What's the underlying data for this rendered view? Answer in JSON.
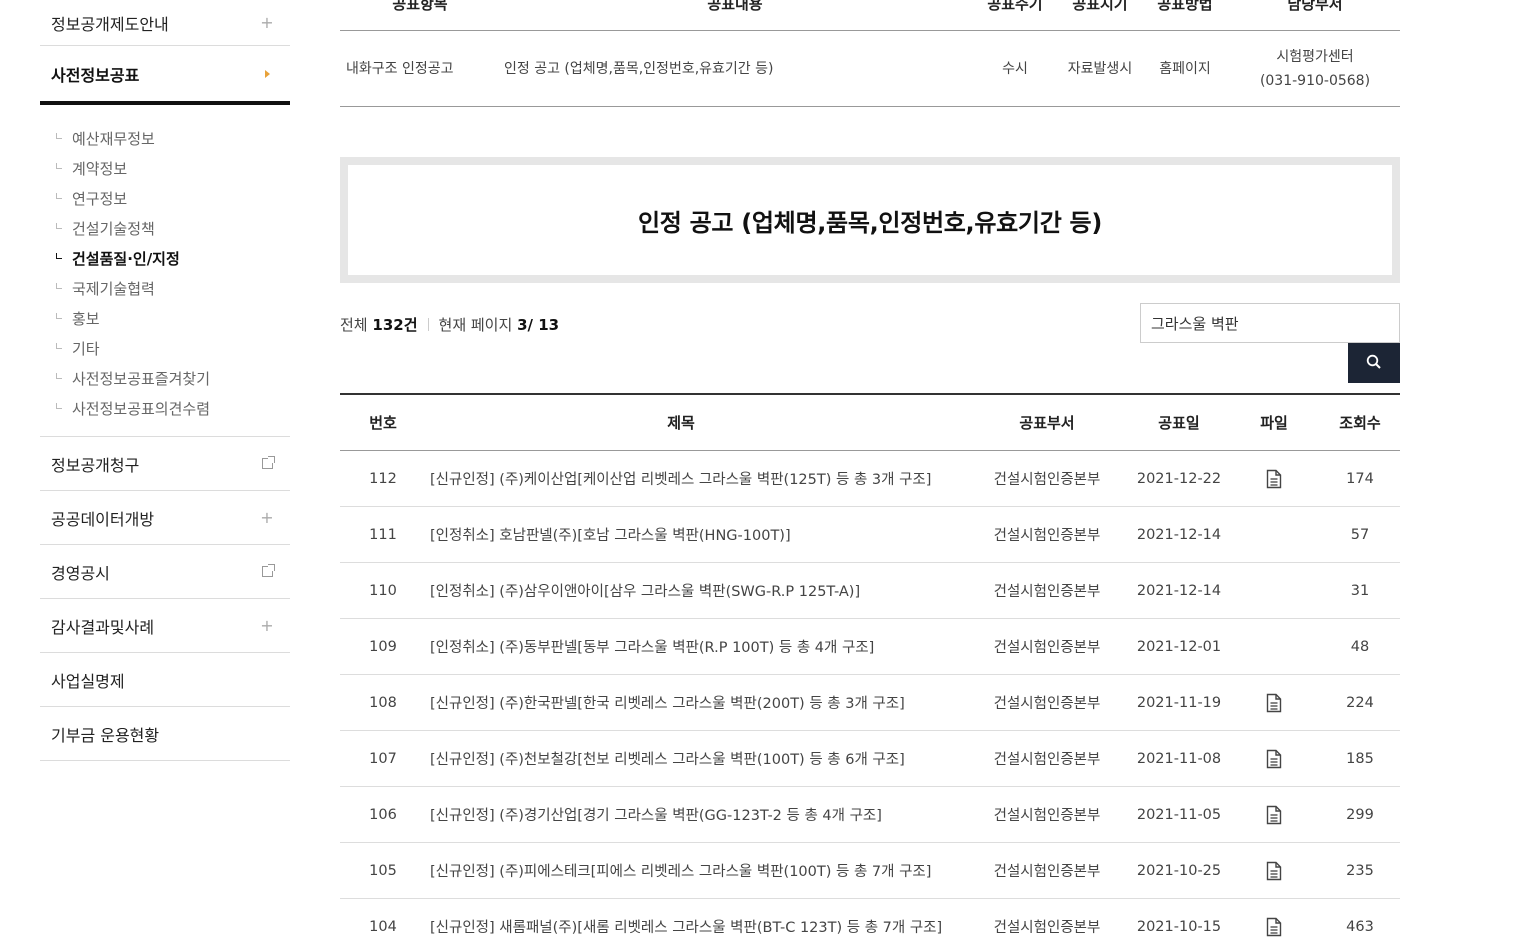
{
  "sidebar": {
    "top_item": "정보공개제도안내",
    "active_item": "사전정보공표",
    "sub_items": [
      {
        "label": "예산재무정보",
        "on": false
      },
      {
        "label": "계약정보",
        "on": false
      },
      {
        "label": "연구정보",
        "on": false
      },
      {
        "label": "건설기술정책",
        "on": false
      },
      {
        "label": "건설품질·인/지정",
        "on": true
      },
      {
        "label": "국제기술협력",
        "on": false
      },
      {
        "label": "홍보",
        "on": false
      },
      {
        "label": "기타",
        "on": false
      },
      {
        "label": "사전정보공표즐겨찾기",
        "on": false
      },
      {
        "label": "사전정보공표의견수렴",
        "on": false
      }
    ],
    "bottom_items": [
      {
        "label": "정보공개청구",
        "icon": "external-link-icon"
      },
      {
        "label": "공공데이터개방",
        "icon": "plus-icon"
      },
      {
        "label": "경영공시",
        "icon": "external-link-icon"
      },
      {
        "label": "감사결과및사례",
        "icon": "plus-icon"
      },
      {
        "label": "사업실명제",
        "icon": ""
      },
      {
        "label": "기부금 운용현황",
        "icon": ""
      }
    ]
  },
  "top_table": {
    "headers": [
      "공표항목",
      "공표내용",
      "공표주기",
      "공표시기",
      "공표방법",
      "담당부서"
    ],
    "row": {
      "item": "내화구조 인정공고",
      "content": "인정 공고 (업체명,품목,인정번호,유효기간 등)",
      "cycle": "수시",
      "timing": "자료발생시",
      "method": "홈페이지",
      "dept_line1": "시험평가센터",
      "dept_line2": "(031-910-0568)"
    }
  },
  "page_title": "인정 공고 (업체명,품목,인정번호,유효기간 등)",
  "count": {
    "total_label": "전체",
    "total_value": "132건",
    "page_label": "현재 페이지",
    "page_value": "3/ 13"
  },
  "search": {
    "value": "그라스울 벽판",
    "button_icon": "search-icon"
  },
  "list": {
    "headers": {
      "no": "번호",
      "title": "제목",
      "dept": "공표부서",
      "date": "공표일",
      "file": "파일",
      "views": "조회수"
    },
    "rows": [
      {
        "no": "112",
        "title": "[신규인정] (주)케이산업[케이산업 리벳레스 그라스울 벽판(125T) 등 총 3개 구조]",
        "dept": "건설시험인증본부",
        "date": "2021-12-22",
        "file": true,
        "views": "174"
      },
      {
        "no": "111",
        "title": "[인정취소] 호남판넬(주)[호남 그라스울 벽판(HNG-100T)]",
        "dept": "건설시험인증본부",
        "date": "2021-12-14",
        "file": false,
        "views": "57"
      },
      {
        "no": "110",
        "title": "[인정취소] (주)삼우이앤아이[삼우 그라스울 벽판(SWG-R.P 125T-A)]",
        "dept": "건설시험인증본부",
        "date": "2021-12-14",
        "file": false,
        "views": "31"
      },
      {
        "no": "109",
        "title": "[인정취소] (주)동부판넬[동부 그라스울 벽판(R.P 100T) 등 총 4개 구조]",
        "dept": "건설시험인증본부",
        "date": "2021-12-01",
        "file": false,
        "views": "48"
      },
      {
        "no": "108",
        "title": "[신규인정] (주)한국판넬[한국 리벳레스 그라스울 벽판(200T) 등 총 3개 구조]",
        "dept": "건설시험인증본부",
        "date": "2021-11-19",
        "file": true,
        "views": "224"
      },
      {
        "no": "107",
        "title": "[신규인정] (주)천보철강[천보 리벳레스 그라스울 벽판(100T) 등 총 6개 구조]",
        "dept": "건설시험인증본부",
        "date": "2021-11-08",
        "file": true,
        "views": "185"
      },
      {
        "no": "106",
        "title": "[신규인정] (주)경기산업[경기 그라스울 벽판(GG-123T-2 등 총 4개 구조]",
        "dept": "건설시험인증본부",
        "date": "2021-11-05",
        "file": true,
        "views": "299"
      },
      {
        "no": "105",
        "title": "[신규인정] (주)피에스테크[피에스 리벳레스 그라스울 벽판(100T) 등 총 7개 구조]",
        "dept": "건설시험인증본부",
        "date": "2021-10-25",
        "file": true,
        "views": "235"
      },
      {
        "no": "104",
        "title": "[신규인정] 새롬패널(주)[새롬 리벳레스 그라스울 벽판(BT-C 123T) 등 총 7개 구조]",
        "dept": "건설시험인증본부",
        "date": "2021-10-15",
        "file": true,
        "views": "463"
      }
    ]
  },
  "colors": {
    "accent_triangle": "#e8a23a",
    "search_button": "#1c2535"
  }
}
